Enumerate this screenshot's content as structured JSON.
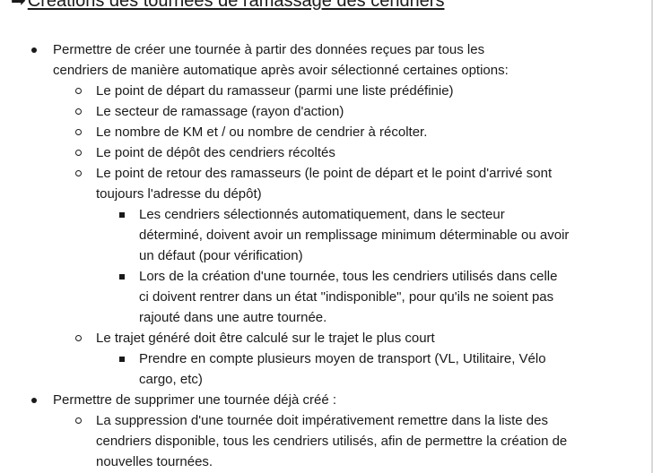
{
  "heading": {
    "arrow": "➡",
    "title": "Créations des tournées de ramassage des cendriers"
  },
  "items": [
    {
      "level": 1,
      "text": "Permettre de créer une tournée à partir des données reçues par tous les cendriers de manière automatique après avoir sélectionné certaines options:"
    },
    {
      "level": 2,
      "text": "Le point de départ du ramasseur (parmi une liste prédéfinie)"
    },
    {
      "level": 2,
      "text": "Le secteur de ramassage (rayon d'action)"
    },
    {
      "level": 2,
      "text": "Le nombre de KM et / ou nombre de cendrier à récolter."
    },
    {
      "level": 2,
      "text": "Le point de dépôt des cendriers récoltés"
    },
    {
      "level": 2,
      "text": "Le point de retour des ramasseurs (le point de départ et le point d'arrivé sont toujours l'adresse du dépôt)"
    },
    {
      "level": 3,
      "text": "Les cendriers sélectionnés automatiquement, dans le secteur déterminé, doivent avoir un remplissage minimum déterminable ou avoir un défaut (pour vérification)"
    },
    {
      "level": 3,
      "text": "Lors de la création d'une tournée, tous les cendriers utilisés dans celle ci doivent rentrer dans un état \"indisponible\", pour qu'ils ne soient pas rajouté dans une autre tournée."
    },
    {
      "level": 2,
      "text": "Le trajet généré doit être calculé sur le trajet le plus court"
    },
    {
      "level": 3,
      "text": "Prendre en compte plusieurs moyen de transport (VL, Utilitaire, Vélo cargo, etc)"
    },
    {
      "level": 1,
      "text": "Permettre de supprimer une tournée déjà créé :"
    },
    {
      "level": 2,
      "text": "La suppression d'une tournée doit impérativement remettre dans la liste des cendriers disponible, tous les cendriers utilisés, afin de permettre la création de nouvelles tournées."
    }
  ]
}
